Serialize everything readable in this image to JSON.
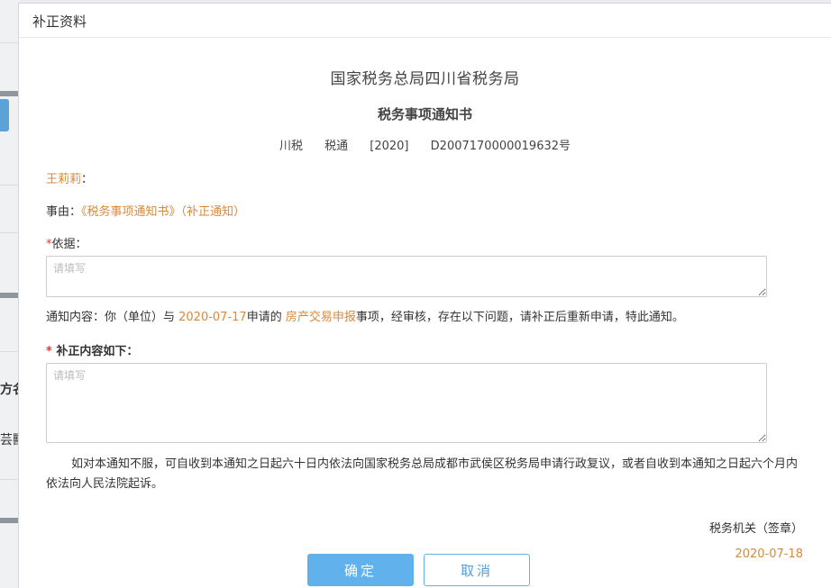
{
  "background": {
    "fragment_1": "方名",
    "fragment_2": "芸獸"
  },
  "dialog": {
    "title": "补正资料",
    "org_name": "国家税务总局四川省税务局",
    "doc_title": "税务事项通知书",
    "doc_number": {
      "prefix": "川税",
      "type": "税通",
      "year": "[2020]",
      "number": "D2007170000019632号"
    },
    "addressee": "王莉莉",
    "addressee_colon": "：",
    "reason_label": "事由：",
    "reason_value": "《税务事项通知书》（补正通知）",
    "basis_label": "依据：",
    "basis_placeholder": "请填写",
    "notice": {
      "prefix": "通知内容：你（单位）与 ",
      "date": "2020-07-17",
      "mid": "申请的 ",
      "item": "房产交易申报",
      "suffix": "事项，经审核，存在以下问题，请补正后重新申请，特此通知。"
    },
    "supplement_label": " 补正内容如下：",
    "supplement_placeholder": "请填写",
    "appeal_text": "如对本通知不服，可自收到本通知之日起六十日内依法向国家税务总局成都市武侯区税务局申请行政复议，或者自收到本通知之日起六个月内依法向人民法院起诉。",
    "signature": "税务机关（签章）",
    "sign_date": "2020-07-18",
    "required_mark": "*",
    "buttons": {
      "ok": "确定",
      "cancel": "取消"
    }
  },
  "colors": {
    "accent_orange": "#d9893a",
    "primary_blue": "#61b1ec",
    "required_red": "#e23a3a"
  }
}
